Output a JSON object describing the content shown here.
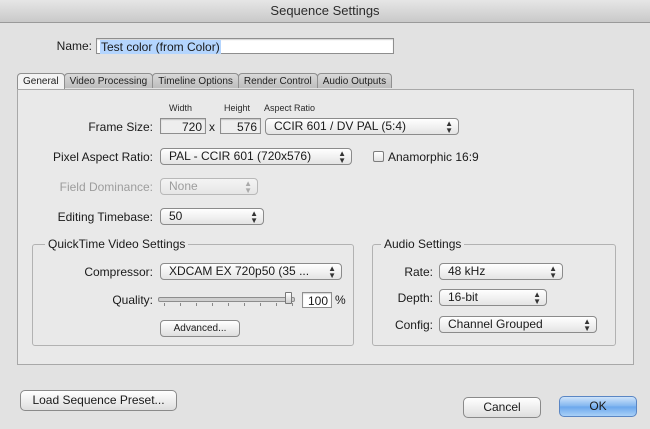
{
  "window": {
    "title": "Sequence Settings"
  },
  "name": {
    "label": "Name:",
    "value": "Test color (from Color)"
  },
  "tabs": [
    {
      "label": "General",
      "active": true
    },
    {
      "label": "Video Processing",
      "active": false
    },
    {
      "label": "Timeline Options",
      "active": false
    },
    {
      "label": "Render Control",
      "active": false
    },
    {
      "label": "Audio Outputs",
      "active": false
    }
  ],
  "general": {
    "width_label": "Width",
    "height_label": "Height",
    "aspect_ratio_label": "Aspect Ratio",
    "frame_size_label": "Frame Size:",
    "width_value": "720",
    "times": "x",
    "height_value": "576",
    "aspect_ratio_value": "CCIR 601 / DV PAL (5:4)",
    "pixel_aspect_label": "Pixel Aspect Ratio:",
    "pixel_aspect_value": "PAL - CCIR 601 (720x576)",
    "anamorphic_label": "Anamorphic 16:9",
    "anamorphic_checked": false,
    "field_dominance_label": "Field Dominance:",
    "field_dominance_value": "None",
    "editing_timebase_label": "Editing Timebase:",
    "editing_timebase_value": "50"
  },
  "quicktime": {
    "title": "QuickTime Video Settings",
    "compressor_label": "Compressor:",
    "compressor_value": "XDCAM EX 720p50 (35 ...",
    "quality_label": "Quality:",
    "quality_value": "100",
    "quality_unit": "%",
    "advanced_label": "Advanced..."
  },
  "audio": {
    "title": "Audio Settings",
    "rate_label": "Rate:",
    "rate_value": "48 kHz",
    "depth_label": "Depth:",
    "depth_value": "16-bit",
    "config_label": "Config:",
    "config_value": "Channel Grouped"
  },
  "footer": {
    "load_preset_label": "Load Sequence Preset...",
    "cancel_label": "Cancel",
    "ok_label": "OK"
  },
  "icons": {
    "popup_arrows": "up-down-arrows-icon",
    "slider_thumb": "slider-thumb"
  },
  "colors": {
    "selection": "#b4d5fe",
    "default_button": "#6aa6ec"
  }
}
